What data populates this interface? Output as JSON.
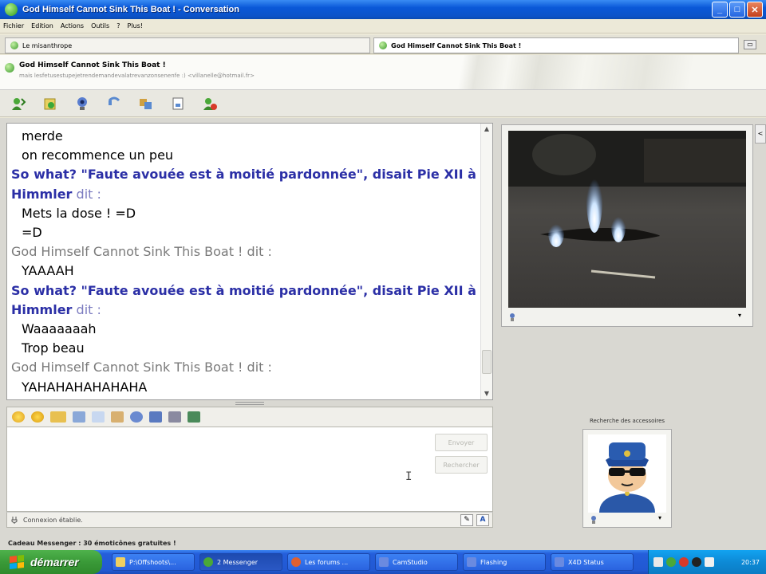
{
  "window": {
    "title": "God Himself Cannot Sink This Boat ! - Conversation",
    "minimize": "_",
    "maximize": "□",
    "close": "✕"
  },
  "menu": [
    "Fichier",
    "Edition",
    "Actions",
    "Outils",
    "?",
    "Plus!"
  ],
  "tabs": [
    {
      "label": "Le misanthrope"
    },
    {
      "label": "God Himself Cannot Sink This Boat !"
    }
  ],
  "tab_close": "▭",
  "contact": {
    "name": "God Himself Cannot Sink This Boat !",
    "subtitle": "mais lesfetusestupejetrendemandevalatrevanzonsenenfe :) <villanelle@hotmail.fr>"
  },
  "toolbar_icons": [
    "invite-icon",
    "send-files-icon",
    "webcam-icon",
    "call-icon",
    "activities-icon",
    "games-icon",
    "block-icon"
  ],
  "messages": [
    {
      "kind": "msg",
      "text": "merde"
    },
    {
      "kind": "msg",
      "text": "on recommence un peu"
    },
    {
      "kind": "sender-blue",
      "text": "So what? \"Faute avouée est à moitié pardonnée\", disait Pie XII à"
    },
    {
      "kind": "sender-blue",
      "text": "Himmler",
      "suffix": " dit :"
    },
    {
      "kind": "msg",
      "text": "Mets la dose ! =D"
    },
    {
      "kind": "msg",
      "text": "=D"
    },
    {
      "kind": "sender-gray",
      "text": "God Himself Cannot Sink This Boat ! dit :"
    },
    {
      "kind": "msg",
      "text": "YAAAAH"
    },
    {
      "kind": "sender-blue",
      "text": "So what? \"Faute avouée est à moitié pardonnée\", disait Pie XII à"
    },
    {
      "kind": "sender-blue",
      "text": "Himmler",
      "suffix": " dit :"
    },
    {
      "kind": "msg",
      "text": "Waaaaaaah"
    },
    {
      "kind": "msg",
      "text": "Trop beau"
    },
    {
      "kind": "sender-gray",
      "text": "God Himself Cannot Sink This Boat ! dit :"
    },
    {
      "kind": "msg",
      "text": "YAHAHAHAHAHAHA"
    }
  ],
  "compose": {
    "send_label": "Envoyer",
    "search_label": "Rechercher",
    "status_text": "Connexion établie."
  },
  "avatar_label": "Recherche des accessoires",
  "ad_text": "Cadeau Messenger : 30 émoticônes gratuites !",
  "taskbar": {
    "start_label": "démarrer",
    "tasks": [
      {
        "label": "P:\\Offshoots\\..."
      },
      {
        "label": "2 Messenger"
      },
      {
        "label": "Les forums ..."
      },
      {
        "label": "CamStudio"
      },
      {
        "label": "Flashing"
      },
      {
        "label": "X4D Status"
      }
    ],
    "clock": "20:37"
  },
  "colors": {
    "titlebar": "#0a58d8",
    "sender_blue": "#2b2fa6",
    "sender_gray": "#7a7a7a",
    "start_green": "#3a9a38"
  }
}
